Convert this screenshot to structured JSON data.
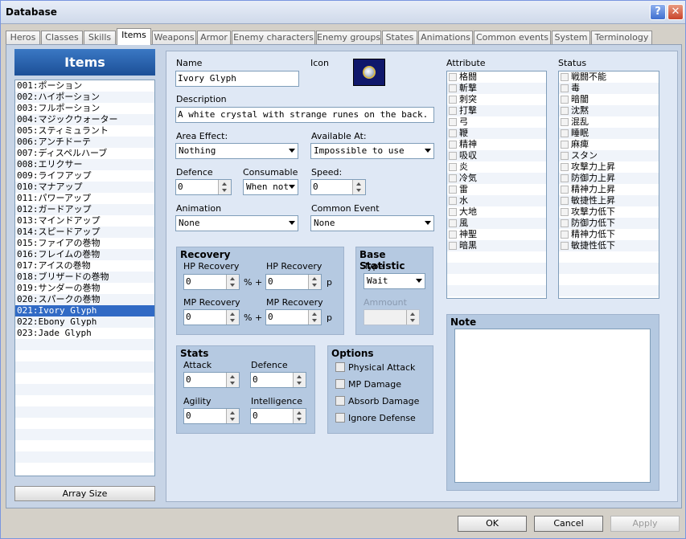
{
  "window": {
    "title": "Database",
    "help_label": "?",
    "close_label": "✕"
  },
  "tabs": [
    "Heros",
    "Classes",
    "Skills",
    "Items",
    "Weapons",
    "Armor",
    "Enemy characters",
    "Enemy groups",
    "States",
    "Animations",
    "Common events",
    "System",
    "Terminology"
  ],
  "active_tab": "Items",
  "sidebar": {
    "header": "Items",
    "items": [
      "001:ポーション",
      "002:ハイポーション",
      "003:フルポーション",
      "004:マジックウォーター",
      "005:スティミュラント",
      "006:アンチドーテ",
      "007:ディスペルハーブ",
      "008:エリクサー",
      "009:ライフアップ",
      "010:マナアップ",
      "011:パワーアップ",
      "012:ガードアップ",
      "013:マインドアップ",
      "014:スピードアップ",
      "015:ファイアの巻物",
      "016:フレイムの巻物",
      "017:アイスの巻物",
      "018:ブリザードの巻物",
      "019:サンダーの巻物",
      "020:スパークの巻物",
      "021:Ivory Glyph",
      "022:Ebony Glyph",
      "023:Jade Glyph"
    ],
    "selected_index": 20,
    "array_size_label": "Array Size"
  },
  "form": {
    "name_label": "Name",
    "name_value": "Ivory Glyph",
    "icon_label": "Icon",
    "icon_name": "white-orb-icon",
    "description_label": "Description",
    "description_value": "A white crystal with strange runes on the back.",
    "area_effect_label": "Area Effect:",
    "area_effect_value": "Nothing",
    "available_at_label": "Available At:",
    "available_at_value": "Impossible to use",
    "defence_label": "Defence",
    "defence_value": "0",
    "consumable_label": "Consumable",
    "consumable_value": "When not",
    "speed_label": "Speed:",
    "speed_value": "0",
    "animation_label": "Animation",
    "animation_value": "None",
    "common_event_label": "Common Event",
    "common_event_value": "None"
  },
  "recovery": {
    "title": "Recovery",
    "hp_pct_label": "HP Recovery",
    "hp_pct_value": "0",
    "hp_pct_unit": "% +",
    "hp_label": "HP Recovery",
    "hp_value": "0",
    "hp_unit": "p",
    "mp_pct_label": "MP Recovery",
    "mp_pct_value": "0",
    "mp_pct_unit": "% +",
    "mp_label": "MP Recovery",
    "mp_value": "0",
    "mp_unit": "p"
  },
  "base_statistic": {
    "title": "Base Statistic",
    "type_label": "Type",
    "type_value": "Wait",
    "amount_label": "Ammount"
  },
  "stats": {
    "title": "Stats",
    "attack_label": "Attack",
    "attack_value": "0",
    "defence_label": "Defence",
    "defence_value": "0",
    "agility_label": "Agility",
    "agility_value": "0",
    "intelligence_label": "Intelligence",
    "intelligence_value": "0"
  },
  "options": {
    "title": "Options",
    "items": [
      "Physical Attack",
      "MP Damage",
      "Absorb Damage",
      "Ignore Defense"
    ]
  },
  "attribute": {
    "title": "Attribute",
    "items": [
      "格闘",
      "斬撃",
      "刺突",
      "打撃",
      "弓",
      "鞭",
      "精神",
      "吸収",
      "炎",
      "冷気",
      "雷",
      "水",
      "大地",
      "風",
      "神聖",
      "暗黒"
    ]
  },
  "status": {
    "title": "Status",
    "items": [
      "戦闘不能",
      "毒",
      "暗闇",
      "沈黙",
      "混乱",
      "睡眠",
      "麻痺",
      "スタン",
      "攻撃力上昇",
      "防御力上昇",
      "精神力上昇",
      "敏捷性上昇",
      "攻撃力低下",
      "防御力低下",
      "精神力低下",
      "敏捷性低下"
    ]
  },
  "note": {
    "title": "Note"
  },
  "footer": {
    "ok": "OK",
    "cancel": "Cancel",
    "apply": "Apply"
  },
  "colors": {
    "selection": "#316ac5",
    "panel_bg": "#c7d4e6",
    "group_bg": "#b5c9e1",
    "header_blue": "#1c4f97"
  }
}
